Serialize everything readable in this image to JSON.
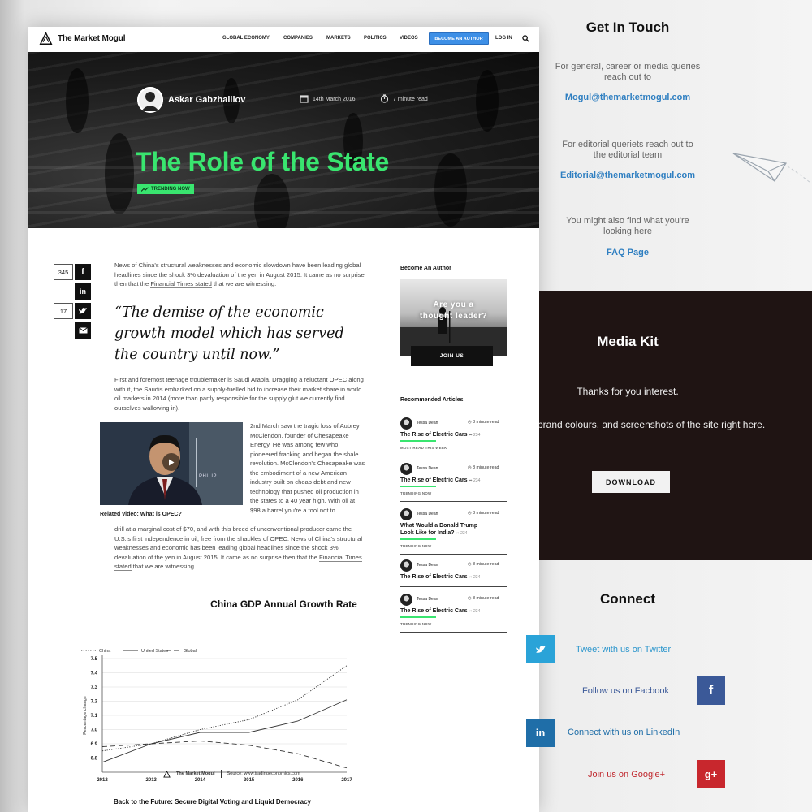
{
  "brand": {
    "name": "The Market Mogul",
    "accent": "#39e56f",
    "cta_blue": "#3d8fe6"
  },
  "nav": {
    "items": [
      "GLOBAL ECONOMY",
      "COMPANIES",
      "MARKETS",
      "POLITICS",
      "VIDEOS"
    ],
    "cta": "BECOME AN AUTHOR",
    "login": "LOG IN",
    "search_icon": "search-icon"
  },
  "hero": {
    "author": "Askar Gabzhalilov",
    "date": "14th March 2016",
    "read_time": "7 minute read",
    "title": "The Role of the State",
    "badge": "TRENDING NOW"
  },
  "share": {
    "facebook_count": "345",
    "twitter_count": "17",
    "buttons": [
      "facebook",
      "linkedin",
      "twitter",
      "email"
    ]
  },
  "article": {
    "p1": "News of China's structural weaknesses and economic slowdown have been leading global headlines since the shock 3% devaluation of the yen in August 2015. It came as no surprise then that the ",
    "p1_link": "Financial Times stated",
    "p1_end": " that we are witnessing:",
    "quote": "“The demise of the economic growth model which has served the country until now.”",
    "p2": "First and foremost teenage troublemaker is Saudi Arabia. Dragging a reluctant OPEC along with it, the Saudis embarked on a supply-fuelled bid to increase their market share in world oil markets in 2014 (more than partly responsible for the supply glut we currently find ourselves wallowing in).",
    "p3_side": "2nd March saw the tragic loss of Aubrey McClendon, founder of Chesapeake Energy. He was among few who pioneered fracking and began the shale revolution. McClendon's Chesapeake was the embodiment of a new American industry built on cheap debt and new technology that pushed oil production in the states to a 40 year high. With oil at $98 a barrel you're a fool not to",
    "p3_full": "drill at a marginal cost of $70, and with this breed of unconventional producer came the U.S.'s first independence in oil, free from the shackles of OPEC. News of China's structural weaknesses and economic has been leading global headlines since the shock 3% devaluation of the yen in August 2015. It came as no surprise then that the ",
    "p3_link": "Financial Times stated",
    "p3_end": " that we are witnessing.",
    "video_caption": "Related video: What is OPEC?",
    "video_watermark": "PHILIP",
    "next": "Back to the Future: Secure Digital Voting and Liquid Democracy"
  },
  "chart_data": {
    "type": "line",
    "title": "China GDP Annual Growth Rate",
    "ylabel": "Percentage change",
    "xlabel": "",
    "x": [
      2012,
      2013,
      2014,
      2015,
      2016,
      2017
    ],
    "ylim": [
      6.7,
      7.5
    ],
    "yticks": [
      6.8,
      6.9,
      7.0,
      7.1,
      7.2,
      7.3,
      7.4,
      7.5
    ],
    "grid": true,
    "legend": "top-left",
    "series": [
      {
        "name": "China",
        "style": "dotted",
        "values": [
          6.85,
          6.9,
          7.0,
          7.07,
          7.21,
          7.45
        ]
      },
      {
        "name": "United States",
        "style": "solid",
        "values": [
          6.77,
          6.9,
          6.98,
          6.98,
          7.06,
          7.21
        ]
      },
      {
        "name": "Global",
        "style": "dashed",
        "values": [
          6.88,
          6.9,
          6.92,
          6.89,
          6.83,
          6.73
        ]
      }
    ],
    "source_logo": "The Market Mogul",
    "source": "Source: www.tradingeconomics.com"
  },
  "sidebar": {
    "become_author_heading": "Become An Author",
    "promo_text_1": "Are you a",
    "promo_text_2": "thought leader?",
    "join": "JOIN US",
    "recommended_heading": "Recommended Articles",
    "articles": [
      {
        "author": "Tessa Dean",
        "read": "8 minute read",
        "title": "The Rise of Electric Cars",
        "count": "234",
        "tag": "MOST READ THIS WEEK"
      },
      {
        "author": "Tessa Dean",
        "read": "8 minute read",
        "title": "The Rise of Electric Cars",
        "count": "234",
        "tag": "TRENDING NOW"
      },
      {
        "author": "Tessa Dean",
        "read": "8 minute read",
        "title": "What Would a Donald Trump Look Like for India?",
        "count": "234",
        "tag": "TRENDING NOW"
      },
      {
        "author": "Tessa Dean",
        "read": "8 minute read",
        "title": "The Rise of Electric Cars",
        "count": "234",
        "tag": ""
      },
      {
        "author": "Tessa Dean",
        "read": "8 minute read",
        "title": "The Rise of Electric Cars",
        "count": "234",
        "tag": "TRENDING NOW"
      }
    ]
  },
  "contact": {
    "title": "Get In Touch",
    "general_text_1": "For general, career or media queries",
    "general_text_2": "reach out to",
    "general_email": "Mogul@themarketmogul.com",
    "editorial_text_1": "For editorial queriets reach out to",
    "editorial_text_2": "the editorial team",
    "editorial_email": "Editorial@themarketmogul.com",
    "faq_text_1": "You might also find what you're",
    "faq_text_2": "looking here",
    "faq_link": "FAQ Page"
  },
  "media_kit": {
    "title": "Media Kit",
    "thanks": "Thanks for you interest.",
    "brand_text": "brand colours, and screenshots of the site right here.",
    "download": "DOWNLOAD"
  },
  "connect": {
    "title": "Connect",
    "twitter": "Tweet with us on Twitter",
    "facebook": "Follow us on Facbook",
    "linkedin": "Connect with us on LinkedIn",
    "google": "Join us on Google+",
    "colors": {
      "twitter": "#1da1f2",
      "facebook": "#3b5998",
      "linkedin": "#0e76a8",
      "google": "#c8272d"
    }
  }
}
